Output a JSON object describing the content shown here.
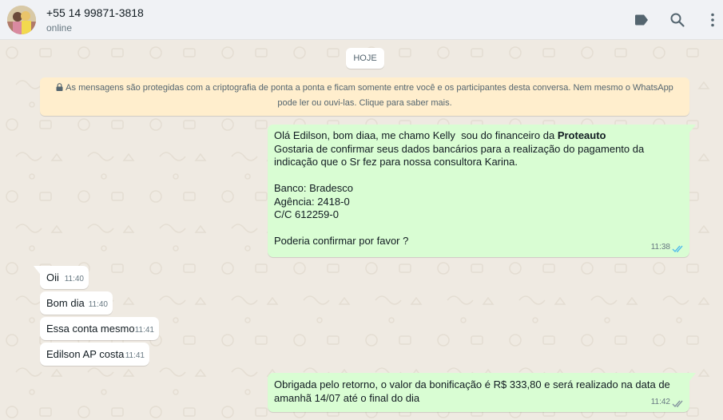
{
  "header": {
    "contact_name": "+55 14 99871-3818",
    "status": "online",
    "icons": [
      "label-icon",
      "search-icon",
      "menu-icon"
    ]
  },
  "chat": {
    "date_chip": "HOJE",
    "encryption_notice": "As mensagens são protegidas com a criptografia de ponta a ponta e ficam somente entre você e os participantes desta conversa. Nem mesmo o WhatsApp pode ler ou ouvi-las. Clique para saber mais.",
    "messages": [
      {
        "direction": "outgoing",
        "text_intro": "Olá Edilson, bom diaa, me chamo Kelly  sou do financeiro da ",
        "text_bold": "Proteauto",
        "text_body": "Gostaria de confirmar seus dados bancários para a realização do pagamento da indicação que o Sr fez para nossa consultora Karina.\n\nBanco: Bradesco\nAgência: 2418-0\nC/C 612259-0\n\nPoderia confirmar por favor ?",
        "time": "11:38",
        "status": "read"
      },
      {
        "direction": "incoming",
        "text": "Oii",
        "time": "11:40"
      },
      {
        "direction": "incoming",
        "text": "Bom dia",
        "time": "11:40"
      },
      {
        "direction": "incoming",
        "text": "Essa conta mesmo",
        "time": "11:41"
      },
      {
        "direction": "incoming",
        "text": "Edilson AP costa",
        "time": "11:41"
      },
      {
        "direction": "outgoing",
        "text": "Obrigada pelo retorno, o valor da bonificação é R$ 333,80 e será realizado na data de amanhã 14/07 até o final do dia",
        "time": "11:42",
        "status": "delivered"
      }
    ]
  },
  "colors": {
    "outgoing_bubble": "#d9fdd3",
    "incoming_bubble": "#ffffff",
    "encryption_bg": "#ffeecd",
    "read_ticks": "#53bdeb",
    "delivered_ticks": "#8696a0"
  }
}
